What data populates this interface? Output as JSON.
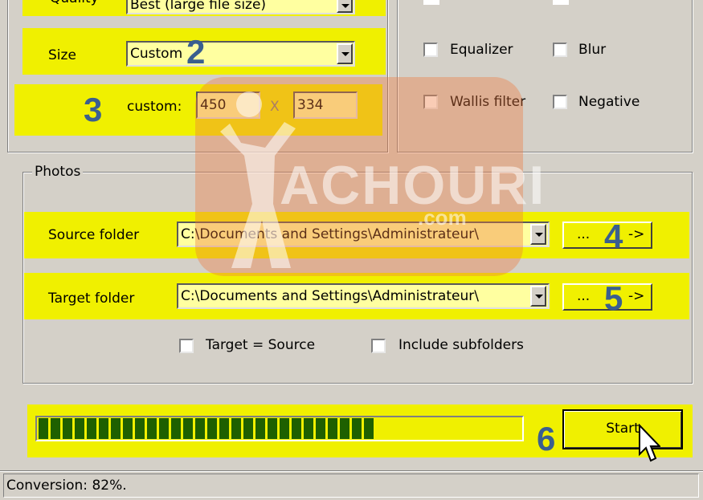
{
  "quality": {
    "label": "Quality",
    "value": "Best (large file size)"
  },
  "size": {
    "label": "Size",
    "value": "Custom"
  },
  "custom": {
    "label": "custom:",
    "width": "450",
    "times": "X",
    "height": "334"
  },
  "filters": {
    "equalizer": "Equalizer",
    "blur": "Blur",
    "wallis": "Wallis filter",
    "negative": "Negative"
  },
  "photos": {
    "group_label": "Photos",
    "source_label": "Source folder",
    "source_value": "C:\\Documents and Settings\\Administrateur\\",
    "target_label": "Target folder",
    "target_value": "C:\\Documents and Settings\\Administrateur\\",
    "browse_label": "...",
    "arrow_label": "->",
    "target_eq_source": "Target = Source",
    "include_subfolders": "Include subfolders"
  },
  "progress": {
    "percent": 82,
    "segments_filled": 28
  },
  "start_label": "Start",
  "status": "Conversion: 82%.",
  "step_numbers": {
    "n2": "2",
    "n3": "3",
    "n4": "4",
    "n5": "5",
    "n6": "6"
  },
  "watermark": {
    "main": "ACHOURI",
    "sub": ".com"
  }
}
